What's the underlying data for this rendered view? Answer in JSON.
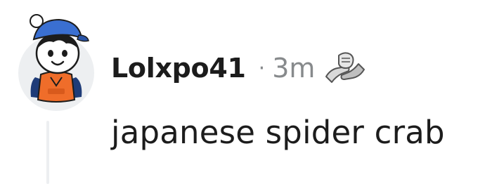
{
  "comment": {
    "username": "Lolxpo41",
    "separator": "·",
    "time_ago": "3m",
    "award_icon": "handshake-award-icon",
    "body": "japanese spider crab"
  },
  "avatar": {
    "icon": "snoo-avatar-icon",
    "colors": {
      "cap": "#3a6fd1",
      "hoodie": "#ef6d2a",
      "backpack": "#1f3c78",
      "background": "#edeff1"
    }
  },
  "colors": {
    "text_primary": "#1c1c1c",
    "text_meta": "#878a8c",
    "thread_line": "#edeff1"
  }
}
